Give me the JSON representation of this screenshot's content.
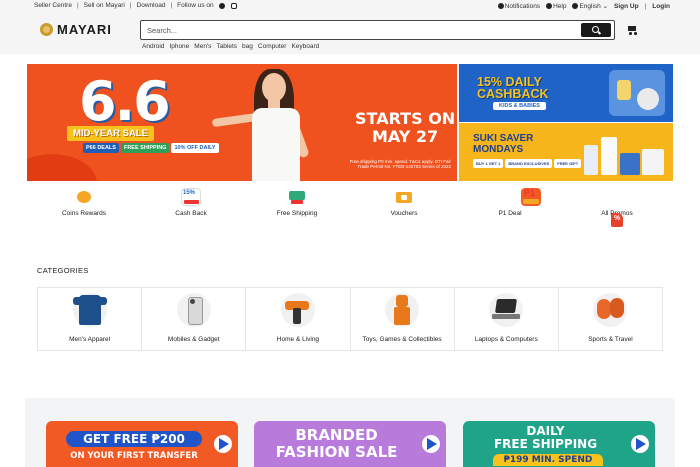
{
  "topbar": {
    "seller_centre": "Seller Centre",
    "sell_on": "Sell on Mayari",
    "download": "Download",
    "follow": "Follow us on",
    "notifications": "Notifications",
    "help": "Help",
    "language": "English",
    "sign_up": "Sign Up",
    "login": "Login"
  },
  "header": {
    "brand": "MAYARI",
    "search_placeholder": "Search...",
    "quick_links": [
      "Android",
      "Iphone",
      "Men's",
      "Tablets",
      "bag",
      "Computer",
      "Keyboard"
    ]
  },
  "banners": {
    "main": {
      "headline": "6.6",
      "sale": "MID-YEAR SALE",
      "deal_1": "P66 DEALS",
      "deal_2": "FREE SHIPPING",
      "deal_3": "10% OFF DAILY",
      "starts_line1": "STARTS ON",
      "starts_line2": "MAY 27",
      "fine_print": "Free shipping P0 min. spend. T&Cs apply. DTI Fair Trade Permit No. FTEB-142703 Series of 2022"
    },
    "side_1": {
      "title_line1": "15% DAILY",
      "title_line2": "CASHBACK",
      "tag": "KIDS & BABIES"
    },
    "side_2": {
      "title_line1": "SUKI SAVER",
      "title_line2": "MONDAYS",
      "chips": [
        "BUY 1 GET 1",
        "BRAND EXCLUSIVES",
        "FREE GIFT"
      ]
    }
  },
  "features": [
    {
      "label": "Coins Rewards",
      "icon": "coins-icon"
    },
    {
      "label": "Cash Back",
      "icon": "cashback-icon"
    },
    {
      "label": "Free Shipping",
      "icon": "truck-icon"
    },
    {
      "label": "Vouchers",
      "icon": "voucher-icon"
    },
    {
      "label": "P1 Deal",
      "icon": "p1-deal-icon"
    },
    {
      "label": "All Promos",
      "icon": "promo-tag-icon"
    }
  ],
  "categories": {
    "title": "CATEGORIES",
    "items": [
      {
        "label": "Men's Apparel"
      },
      {
        "label": "Mobiles & Gadget"
      },
      {
        "label": "Home & Living"
      },
      {
        "label": "Toys, Games & Collectibles"
      },
      {
        "label": "Laptops & Computers"
      },
      {
        "label": "Sports & Travel"
      }
    ]
  },
  "promos": [
    {
      "line1": "GET FREE ₱200",
      "line2": "ON YOUR FIRST TRANSFER"
    },
    {
      "line1": "BRANDED",
      "line2": "FASHION SALE"
    },
    {
      "line1": "DAILY",
      "line2": "FREE SHIPPING",
      "line3": "₱199 MIN. SPEND"
    }
  ],
  "colors": {
    "main_banner": "#f0521f",
    "cashback_banner": "#1f63c6",
    "suki_banner": "#f6b51a"
  }
}
